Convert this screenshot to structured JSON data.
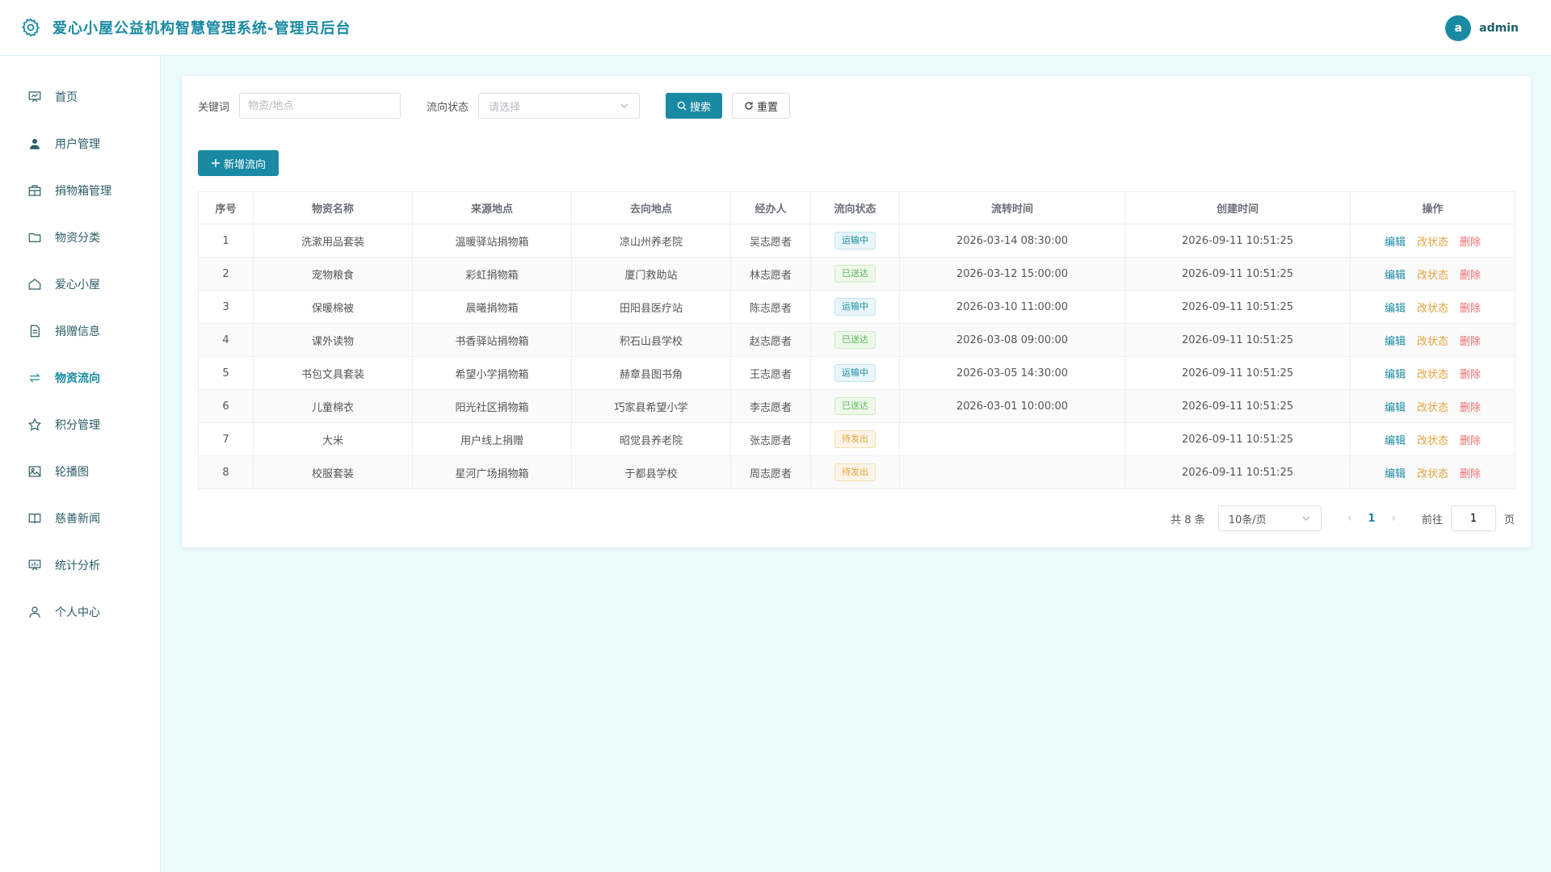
{
  "header": {
    "title": "爱心小屋公益机构智慧管理系统-管理员后台",
    "avatar_letter": "a",
    "username": "admin"
  },
  "sidebar": {
    "items": [
      {
        "label": "首页",
        "icon": "home-board-icon"
      },
      {
        "label": "用户管理",
        "icon": "user-icon"
      },
      {
        "label": "捐物箱管理",
        "icon": "box-icon"
      },
      {
        "label": "物资分类",
        "icon": "folder-icon"
      },
      {
        "label": "爱心小屋",
        "icon": "house-icon"
      },
      {
        "label": "捐赠信息",
        "icon": "document-icon"
      },
      {
        "label": "物资流向",
        "icon": "flow-arrows-icon",
        "active": true
      },
      {
        "label": "积分管理",
        "icon": "star-icon"
      },
      {
        "label": "轮播图",
        "icon": "image-icon"
      },
      {
        "label": "慈善新闻",
        "icon": "book-icon"
      },
      {
        "label": "统计分析",
        "icon": "chart-board-icon"
      },
      {
        "label": "个人中心",
        "icon": "person-icon"
      }
    ]
  },
  "filters": {
    "keyword_label": "关键词",
    "keyword_placeholder": "物资/地点",
    "status_label": "流向状态",
    "status_placeholder": "请选择",
    "search_label": "搜索",
    "reset_label": "重置"
  },
  "add_button_label": "新增流向",
  "table": {
    "headers": [
      "序号",
      "物资名称",
      "来源地点",
      "去向地点",
      "经办人",
      "流向状态",
      "流转时间",
      "创建时间",
      "操作"
    ],
    "rows": [
      {
        "no": "1",
        "name": "洗漱用品套装",
        "from": "温暖驿站捐物箱",
        "to": "凉山州养老院",
        "handler": "吴志愿者",
        "status": "运输中",
        "status_type": "transit",
        "flow_time": "2026-03-14 08:30:00",
        "created": "2026-09-11 10:51:25"
      },
      {
        "no": "2",
        "name": "宠物粮食",
        "from": "彩虹捐物箱",
        "to": "厦门救助站",
        "handler": "林志愿者",
        "status": "已送达",
        "status_type": "done",
        "flow_time": "2026-03-12 15:00:00",
        "created": "2026-09-11 10:51:25"
      },
      {
        "no": "3",
        "name": "保暖棉被",
        "from": "晨曦捐物箱",
        "to": "田阳县医疗站",
        "handler": "陈志愿者",
        "status": "运输中",
        "status_type": "transit",
        "flow_time": "2026-03-10 11:00:00",
        "created": "2026-09-11 10:51:25"
      },
      {
        "no": "4",
        "name": "课外读物",
        "from": "书香驿站捐物箱",
        "to": "积石山县学校",
        "handler": "赵志愿者",
        "status": "已送达",
        "status_type": "done",
        "flow_time": "2026-03-08 09:00:00",
        "created": "2026-09-11 10:51:25"
      },
      {
        "no": "5",
        "name": "书包文具套装",
        "from": "希望小学捐物箱",
        "to": "赫章县图书角",
        "handler": "王志愿者",
        "status": "运输中",
        "status_type": "transit",
        "flow_time": "2026-03-05 14:30:00",
        "created": "2026-09-11 10:51:25"
      },
      {
        "no": "6",
        "name": "儿童棉衣",
        "from": "阳光社区捐物箱",
        "to": "巧家县希望小学",
        "handler": "李志愿者",
        "status": "已送达",
        "status_type": "done",
        "flow_time": "2026-03-01 10:00:00",
        "created": "2026-09-11 10:51:25"
      },
      {
        "no": "7",
        "name": "大米",
        "from": "用户线上捐赠",
        "to": "昭觉县养老院",
        "handler": "张志愿者",
        "status": "待发出",
        "status_type": "wait",
        "flow_time": "",
        "created": "2026-09-11 10:51:25"
      },
      {
        "no": "8",
        "name": "校服套装",
        "from": "星河广场捐物箱",
        "to": "于都县学校",
        "handler": "周志愿者",
        "status": "待发出",
        "status_type": "wait",
        "flow_time": "",
        "created": "2026-09-11 10:51:25"
      }
    ],
    "ops": {
      "edit": "编辑",
      "status": "改状态",
      "delete": "删除"
    }
  },
  "pagination": {
    "total": "共 8 条",
    "page_size": "10条/页",
    "current_page": "1",
    "goto_label": "前往",
    "goto_value": "1",
    "page_suffix": "页"
  },
  "colors": {
    "accent": "#1a8aa3",
    "background": "#ecfbfd",
    "warning": "#e6a23c",
    "danger": "#f06c6c",
    "success": "#5cb85c"
  }
}
